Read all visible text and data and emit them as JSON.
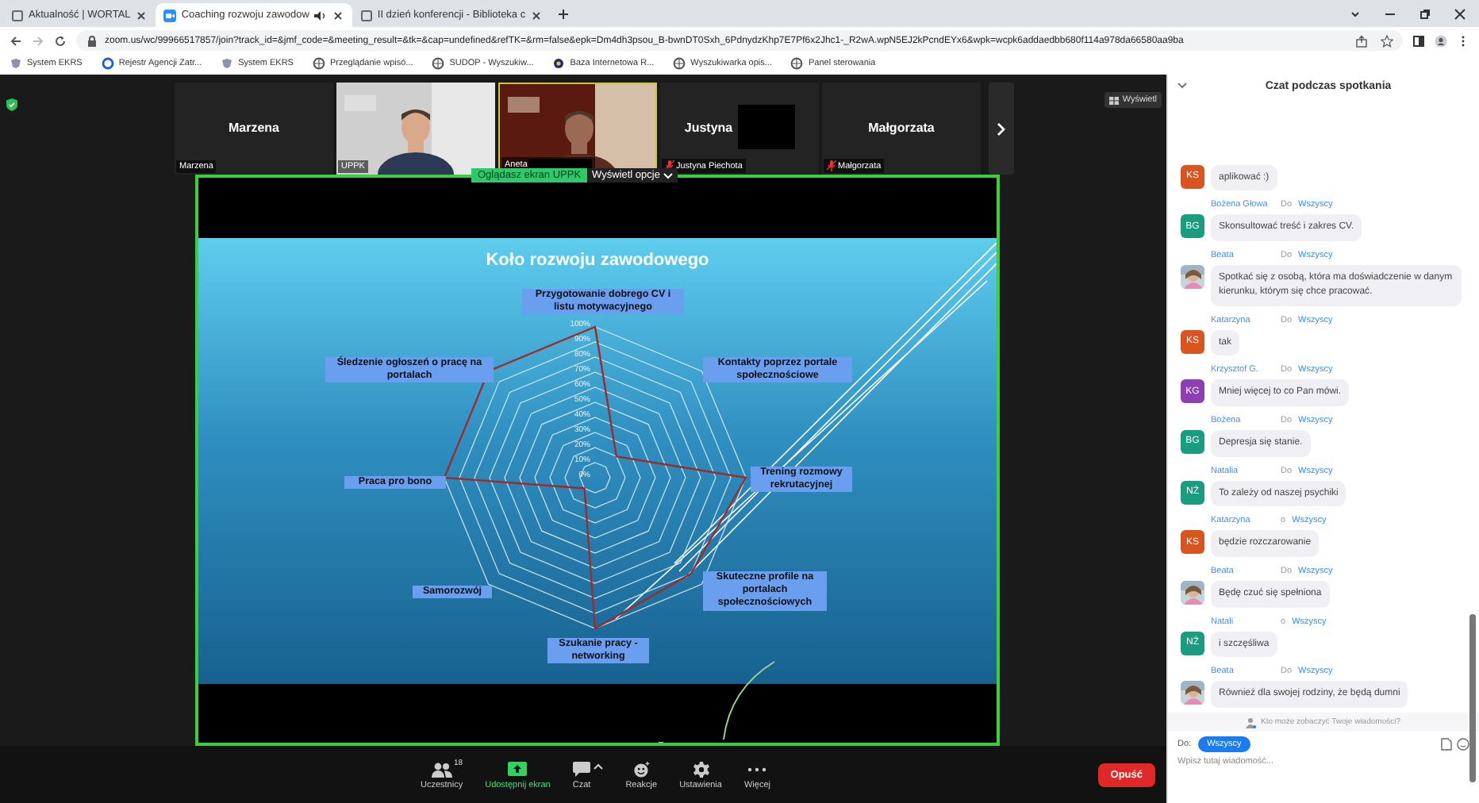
{
  "browser": {
    "tabs": [
      {
        "title": "Aktualność | WORTAL",
        "selected": false,
        "audio": false
      },
      {
        "title": "Coaching rozwoju zawodow",
        "selected": true,
        "audio": true
      },
      {
        "title": "II dzień konferencji - Biblioteka c",
        "selected": false,
        "audio": false
      }
    ],
    "url": "zoom.us/wc/99966517857/join?track_id=&jmf_code=&meeting_result=&tk=&cap=undefined&refTK=&rm=false&epk=Dm4dh3psou_B-bwnDT0Sxh_6PdnydzKhp7E7Pf6x2Jhc1-_R2wA.wpN5EJ2kPcndEYx6&wpk=wcpk6addaedbb680f114a978da66580aa9ba",
    "bookmarks": [
      {
        "label": "System EKRS",
        "kind": "emblem"
      },
      {
        "label": "Rejestr Agencji Zatr...",
        "kind": "ring"
      },
      {
        "label": "System EKRS",
        "kind": "emblem"
      },
      {
        "label": "Przeglądanie wpisó...",
        "kind": "globe"
      },
      {
        "label": "SUDOP - Wyszukiw...",
        "kind": "globe"
      },
      {
        "label": "Baza Internetowa R...",
        "kind": "dot"
      },
      {
        "label": "Wyszukiwarka opis...",
        "kind": "globe"
      },
      {
        "label": "Panel sterowania",
        "kind": "globe"
      }
    ]
  },
  "meeting": {
    "view_button": "Wyświetl",
    "tiles": [
      {
        "kind": "avatar",
        "name": "Marzena",
        "label": "Marzena",
        "muted": false,
        "speaking": false
      },
      {
        "kind": "video",
        "label": "UPPK",
        "muted": false,
        "speaking": false
      },
      {
        "kind": "video",
        "label": "Aneta",
        "muted": false,
        "speaking": true
      },
      {
        "kind": "avatar",
        "name": "Justyna",
        "label": "Justyna Piechota",
        "muted": true,
        "speaking": false
      },
      {
        "kind": "avatar",
        "name": "Małgorzata",
        "label": "Małgorzata",
        "muted": true,
        "speaking": false
      }
    ],
    "banner": {
      "status": "Oglądasz ekran UPPK",
      "options": "Wyświetl opcje"
    },
    "slide": {
      "title": "Koło rozwoju zawodowego",
      "axis_labels": [
        "Przygotowanie dobrego CV i listu motywacyjnego",
        "Śledzenie ogłoszeń o pracę na portalach",
        "Kontakty poprzez portale społecznościowe",
        "Praca pro bono",
        "Trening rozmowy rekrutacyjnej",
        "Samorozwój",
        "Skuteczne profile na portalach społecznościowych",
        "Szukanie pracy - networking"
      ],
      "scale_labels": [
        "100%",
        "90%",
        "80%",
        "70%",
        "60%",
        "50%",
        "40%",
        "30%",
        "20%",
        "10%",
        "0%"
      ]
    },
    "toolbar": [
      {
        "kind": "participants",
        "label": "Uczestnicy",
        "count": "18",
        "active": false
      },
      {
        "kind": "share",
        "label": "Udostępnij ekran",
        "active": true
      },
      {
        "kind": "chat",
        "label": "Czat",
        "active": false
      },
      {
        "kind": "reactions",
        "label": "Reakcje",
        "active": false
      },
      {
        "kind": "settings",
        "label": "Ustawienia",
        "active": false
      },
      {
        "kind": "more",
        "label": "Więcej",
        "active": false
      }
    ],
    "leave_button": "Opuść"
  },
  "chat": {
    "title": "Czat podczas spotkania",
    "messages": [
      {
        "avatar": {
          "kind": "initials",
          "text": "KS",
          "color": "#d9541e"
        },
        "text": "aplikować :)"
      },
      {
        "sender": "Bożena Głowa",
        "do": "Do",
        "to": "Wszyscy",
        "avatar": {
          "kind": "initials",
          "text": "BG",
          "color": "#1a9c7f"
        },
        "text": "Skonsultować treść i zakres CV."
      },
      {
        "sender": "Beata",
        "do": "Do",
        "to": "Wszyscy",
        "text": "Spotkać się z osobą, która ma doświadczenie w danym kierunku, którym się chce pracować."
      },
      {
        "sender": "Katarzyna",
        "do": "Do",
        "to": "Wszyscy",
        "avatar": {
          "kind": "initials",
          "text": "KS",
          "color": "#d9541e"
        },
        "text": "tak"
      },
      {
        "sender": "Krzysztof G.",
        "do": "Do",
        "to": "Wszyscy",
        "avatar": {
          "kind": "initials",
          "text": "KG",
          "color": "#8b3fb0"
        },
        "text": "Mniej więcej to co Pan mówi."
      },
      {
        "sender": "Bożena",
        "do": "Do",
        "to": "Wszyscy",
        "avatar": {
          "kind": "initials",
          "text": "BG",
          "color": "#1a9c7f"
        },
        "text": "Depresja się stanie."
      },
      {
        "sender": "Natalia",
        "do": "Do",
        "to": "Wszyscy",
        "avatar": {
          "kind": "initials",
          "text": "NŻ",
          "color": "#1a9c7f"
        },
        "text": "To zależy od naszej psychiki"
      },
      {
        "sender": "Katarzyna",
        "do": "o",
        "to": "Wszyscy",
        "avatar": {
          "kind": "initials",
          "text": "KS",
          "color": "#d9541e"
        },
        "text": "będzie rozczarowanie"
      },
      {
        "sender": "Beata",
        "do": "Do",
        "to": "Wszyscy",
        "text": "Będę czuć się spełniona"
      },
      {
        "sender": "Natali",
        "do": "o",
        "to": "Wszyscy",
        "avatar": {
          "kind": "initials",
          "text": "NŻ",
          "color": "#1a9c7f"
        },
        "text": "i szczęśliwa"
      },
      {
        "sender": "Beata",
        "do": "Do",
        "to": "Wszyscy",
        "text": "Również dla swojej rodziny, że będą dumni"
      }
    ],
    "visibility_note": "Kto może zobaczyć Twoje wiadomości?",
    "recipient_label": "Do:",
    "recipient": "Wszyscy",
    "input": {
      "placeholder": "Wpisz tutaj wiadomość..."
    }
  }
}
